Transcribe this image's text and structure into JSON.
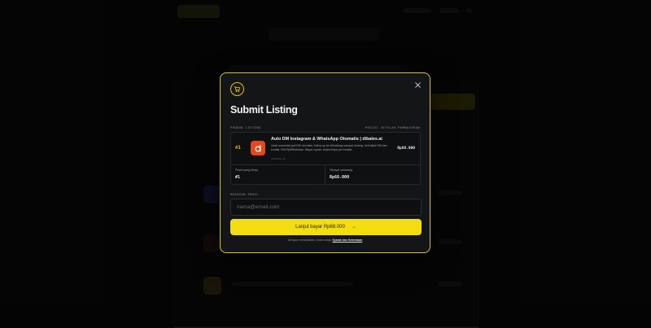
{
  "modal": {
    "title": "Submit Listing",
    "section_listing_label": "PRODUK LISTING",
    "section_position_label": "POSISI SETELAH PEMBAYARAN",
    "listing": {
      "rank": "#1",
      "name": "Auto DM Instagram & WhatsApp Otomatis | dibales.ai",
      "description": "Ubah komentar jadi DM otomatis, follow-up ke WhatsApp sampai closing. Unlimited DM dan kontak. Flat Rp99rb/bulan. Bayar rupiah, tanpa biaya per kontak.",
      "domain": "dibales.ai",
      "price": "Rp68.000"
    },
    "stats": {
      "target_label": "Posisi yang dituju",
      "target_value": "#1",
      "pay_now_label": "Dibayar sekarang",
      "pay_now_value": "Rp68.000"
    },
    "email_label": "MASUKAN EMAIL",
    "email_placeholder": "nama@email.com",
    "email_value": "",
    "pay_button_label": "Lanjut bayar Rp68.000",
    "pay_button_arrow": "→",
    "terms_prefix": "Dengan melanjutkan, Anda setuju",
    "terms_link": "Syarat dan Ketentuan"
  },
  "icons": {
    "cart": "cart-icon",
    "close": "close-icon",
    "app": "dibales-logo-icon"
  },
  "colors": {
    "accent": "#f2dd12",
    "app_icon": "#e8471e",
    "modal_bg": "#141516"
  }
}
